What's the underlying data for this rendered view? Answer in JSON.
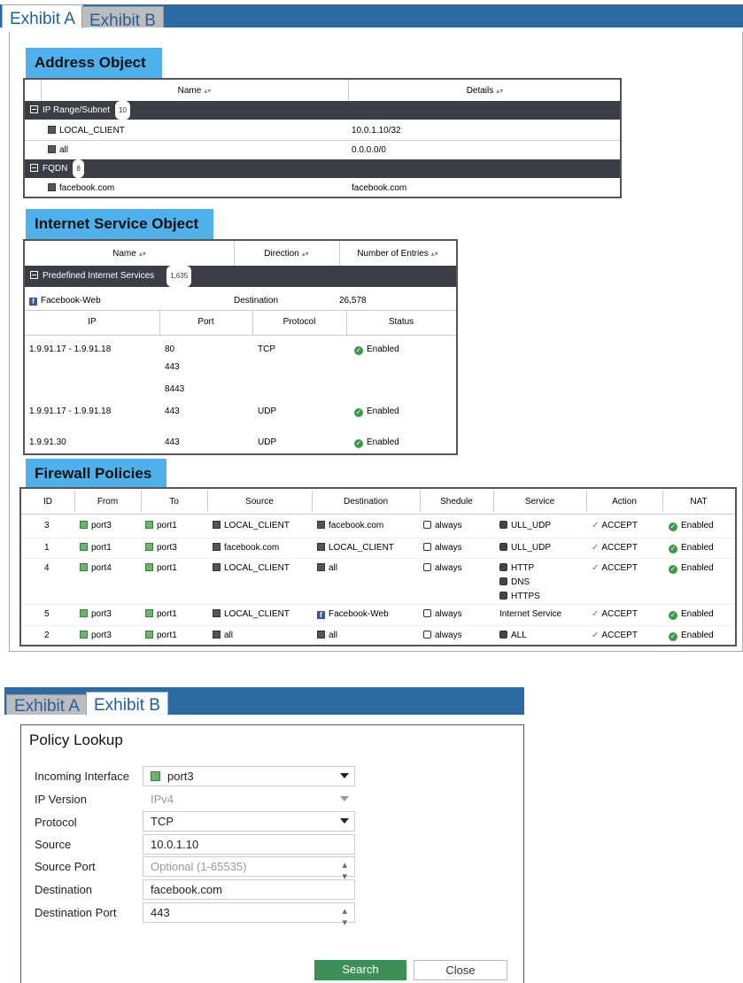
{
  "exhibit_a": {
    "tabs": [
      "Exhibit A",
      "Exhibit B"
    ],
    "address_object": {
      "title": "Address Object",
      "headers": [
        "Name",
        "Details"
      ],
      "groups": [
        {
          "label": "IP Range/Subnet",
          "count": "10",
          "rows": [
            [
              "LOCAL_CLIENT",
              "10.0.1.10/32"
            ],
            [
              "all",
              "0.0.0.0/0"
            ]
          ]
        },
        {
          "label": "FQDN",
          "count": "8",
          "rows": [
            [
              "facebook.com",
              "facebook.com"
            ]
          ]
        }
      ]
    },
    "internet_service": {
      "title": "Internet Service Object",
      "headers": [
        "Name",
        "Direction",
        "Number of Entries"
      ],
      "group": {
        "label": "Predefined Internet Services",
        "count": "1,635"
      },
      "entry": {
        "name": "Facebook-Web",
        "direction": "Destination",
        "entries": "26,578"
      },
      "sub_headers": [
        "IP",
        "Port",
        "Protocol",
        "Status"
      ],
      "rows": [
        {
          "ip": "1.9.91.17 - 1.9.91.18",
          "ports": [
            "80",
            "443",
            "8443"
          ],
          "protocol": "TCP",
          "status": "Enabled"
        },
        {
          "ip": "1.9.91.17 - 1.9.91.18",
          "ports": [
            "443"
          ],
          "protocol": "UDP",
          "status": "Enabled"
        },
        {
          "ip": "1.9.91.30",
          "ports": [
            "443"
          ],
          "protocol": "UDP",
          "status": "Enabled"
        }
      ]
    },
    "firewall_policies": {
      "title": "Firewall Policies",
      "headers": [
        "ID",
        "From",
        "To",
        "Source",
        "Destination",
        "Shedule",
        "Service",
        "Action",
        "NAT"
      ],
      "rows": [
        {
          "id": "3",
          "from": "port3",
          "to": "port1",
          "source": "LOCAL_CLIENT",
          "destination": "facebook.com",
          "dest_icon": "server-icon",
          "schedule": "always",
          "service": [
            "ULL_UDP"
          ],
          "service_icon": true,
          "action": "ACCEPT",
          "nat": "Enabled"
        },
        {
          "id": "1",
          "from": "port1",
          "to": "port3",
          "source": "facebook.com",
          "destination": "LOCAL_CLIENT",
          "dest_icon": "server-icon",
          "schedule": "always",
          "service": [
            "ULL_UDP"
          ],
          "service_icon": true,
          "action": "ACCEPT",
          "nat": "Enabled"
        },
        {
          "id": "4",
          "from": "port4",
          "to": "port1",
          "source": "LOCAL_CLIENT",
          "destination": "all",
          "dest_icon": "server-icon",
          "schedule": "always",
          "service": [
            "HTTP",
            "DNS",
            "HTTPS"
          ],
          "service_icon": true,
          "action": "ACCEPT",
          "nat": "Enabled"
        },
        {
          "id": "5",
          "from": "port3",
          "to": "port1",
          "source": "LOCAL_CLIENT",
          "destination": "Facebook-Web",
          "dest_icon": "facebook-icon",
          "schedule": "always",
          "service": [
            "Internet Service"
          ],
          "service_icon": false,
          "action": "ACCEPT",
          "nat": "Enabled"
        },
        {
          "id": "2",
          "from": "port3",
          "to": "port1",
          "source": "all",
          "destination": "all",
          "dest_icon": "server-icon",
          "schedule": "always",
          "service": [
            "ALL"
          ],
          "service_icon": true,
          "action": "ACCEPT",
          "nat": "Enabled"
        }
      ]
    }
  },
  "exhibit_b": {
    "tabs": [
      "Exhibit A",
      "Exhibit B"
    ],
    "title": "Policy Lookup",
    "fields": {
      "incoming_interface": {
        "label": "Incoming Interface",
        "value": "port3"
      },
      "ip_version": {
        "label": "IP Version",
        "value": "IPv4"
      },
      "protocol": {
        "label": "Protocol",
        "value": "TCP"
      },
      "source": {
        "label": "Source",
        "value": "10.0.1.10"
      },
      "source_port": {
        "label": "Source Port",
        "placeholder": "Optional (1-65535)"
      },
      "destination": {
        "label": "Destination",
        "value": "facebook.com"
      },
      "destination_port": {
        "label": "Destination Port",
        "value": "443"
      }
    },
    "buttons": {
      "search": "Search",
      "close": "Close"
    },
    "colors": {
      "tab_bar": "#2b6aa3",
      "search_button": "#3e8e58"
    }
  }
}
